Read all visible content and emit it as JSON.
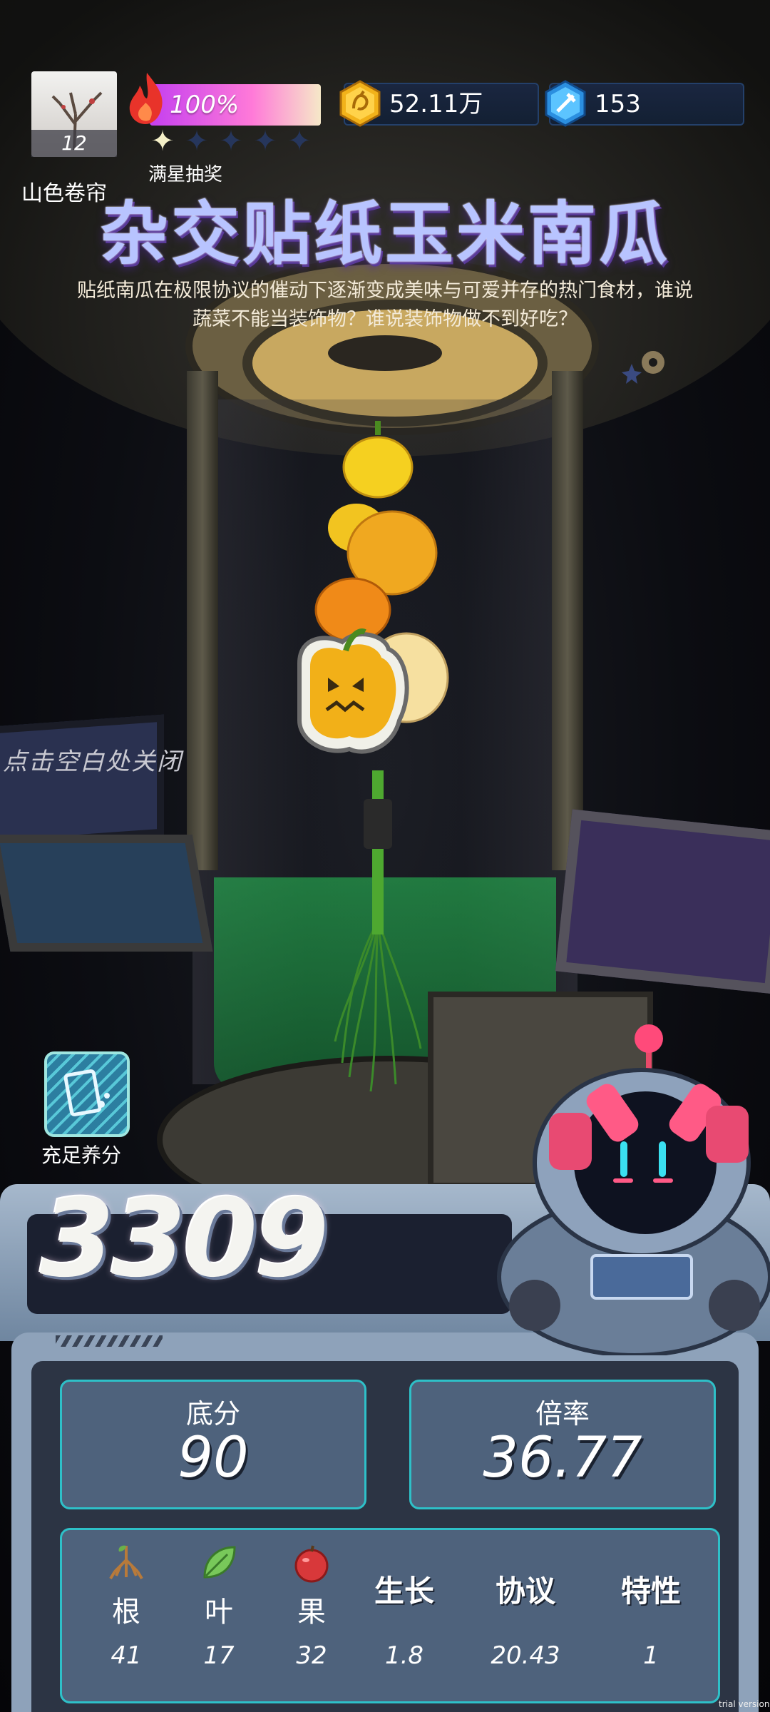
{
  "player": {
    "level": "12",
    "name": "山色卷帘"
  },
  "energy": {
    "percent_text": "100%",
    "stars_filled": 1,
    "stars_total": 5,
    "stars_label": "满星抽奖"
  },
  "resources": {
    "gold": "52.11万",
    "gems": "153"
  },
  "item": {
    "title": "杂交贴纸玉米南瓜",
    "description_line1": "贴纸南瓜在极限协议的催动下逐渐变成美味与可爱并存的热门食材，谁说",
    "description_line2": "蔬菜不能当装饰物？谁说装饰物做不到好吃？"
  },
  "hint": "点击空白处关闭",
  "fertilizer": {
    "label": "充足养分",
    "icon": "fertilizer-icon"
  },
  "result": {
    "score": "3309",
    "base_label": "底分",
    "base_value": "90",
    "multiplier_label": "倍率",
    "multiplier_value": "36.77"
  },
  "attributes": [
    {
      "name": "根",
      "icon": "root-icon",
      "value": "41"
    },
    {
      "name": "叶",
      "icon": "leaf-icon",
      "value": "17"
    },
    {
      "name": "果",
      "icon": "fruit-icon",
      "value": "32"
    },
    {
      "name": "生长",
      "value": "1.8"
    },
    {
      "name": "协议",
      "value": "20.43"
    },
    {
      "name": "特性",
      "value": "1"
    }
  ],
  "watermark": "trial version",
  "colors": {
    "accent_cyan": "#2ec0c8",
    "gold": "#f2b21a",
    "gem": "#2b8fe0",
    "energy_pink": "#ff7ad8"
  }
}
